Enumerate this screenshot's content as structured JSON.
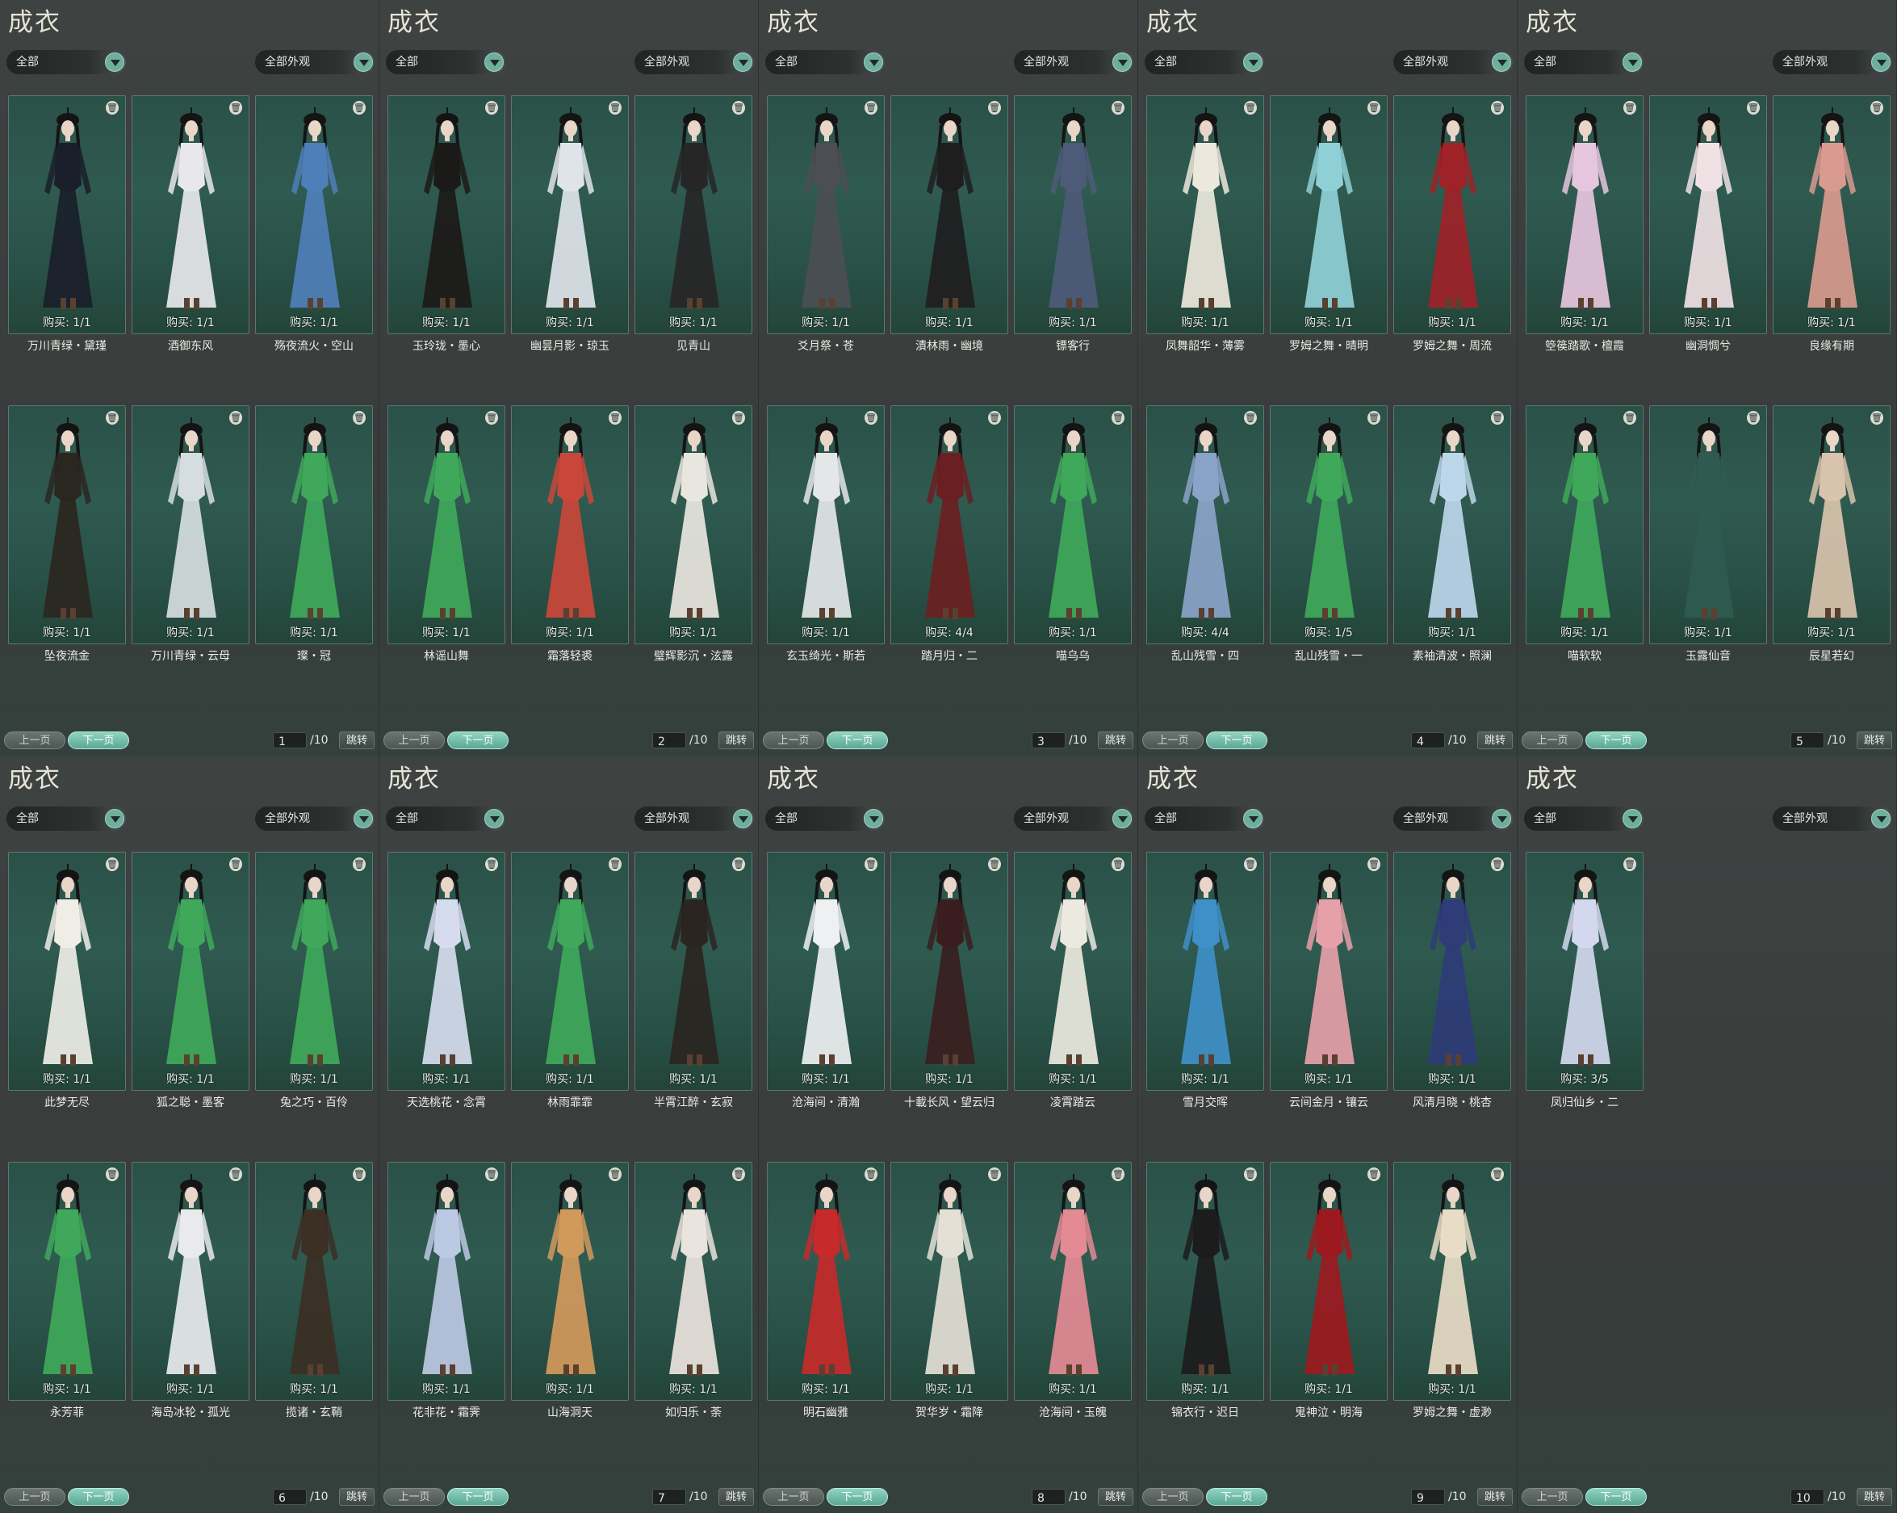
{
  "window": {
    "title": "成衣"
  },
  "colors": {
    "card_bg": "#2a5147",
    "accent": "#6fae9d",
    "page_bg": "#3a3e3d"
  },
  "panels": [
    {
      "title": "成衣",
      "filter_all": "全部",
      "filter_appearance": "全部外观",
      "page": "1",
      "total": "/10",
      "prev": "上一页",
      "next": "下一页",
      "jump": "跳转",
      "items": [
        {
          "name": "万川青绿・黛瑾",
          "buy": "购买: 1/1",
          "fig": "#1a1e2a"
        },
        {
          "name": "酒御东风",
          "buy": "购买: 1/1",
          "fig": "#e8e8ea"
        },
        {
          "name": "殇夜流火・空山",
          "buy": "购买: 1/1",
          "fig": "#4f7fb8"
        },
        {
          "name": "坠夜流金",
          "buy": "购买: 1/1",
          "fig": "#2a2620"
        },
        {
          "name": "万川青绿・云母",
          "buy": "购买: 1/1",
          "fig": "#d6dde0"
        },
        {
          "name": "璨・冠",
          "buy": "购买: 1/1",
          "fig": "#3fa85a"
        }
      ]
    },
    {
      "title": "成衣",
      "filter_all": "全部",
      "filter_appearance": "全部外观",
      "page": "2",
      "total": "/10",
      "prev": "上一页",
      "next": "下一页",
      "jump": "跳转",
      "items": [
        {
          "name": "玉玲珑・墨心",
          "buy": "购买: 1/1",
          "fig": "#1c1a18"
        },
        {
          "name": "幽昙月影・琼玉",
          "buy": "购买: 1/1",
          "fig": "#dfe4ea"
        },
        {
          "name": "见青山",
          "buy": "购买: 1/1",
          "fig": "#262626"
        },
        {
          "name": "林谣山舞",
          "buy": "购买: 1/1",
          "fig": "#3fa85a"
        },
        {
          "name": "霜落轻裘",
          "buy": "购买: 1/1",
          "fig": "#c9473a"
        },
        {
          "name": "璧辉影沉・泫露",
          "buy": "购买: 1/1",
          "fig": "#e9e6df"
        }
      ]
    },
    {
      "title": "成衣",
      "filter_all": "全部",
      "filter_appearance": "全部外观",
      "page": "3",
      "total": "/10",
      "prev": "上一页",
      "next": "下一页",
      "jump": "跳转",
      "items": [
        {
          "name": "爻月祭・苍",
          "buy": "购买: 1/1",
          "fig": "#4b4e52"
        },
        {
          "name": "漬林雨・幽境",
          "buy": "购买: 1/1",
          "fig": "#1e1e1e"
        },
        {
          "name": "镖客行",
          "buy": "购买: 1/1",
          "fig": "#4d5a78"
        },
        {
          "name": "玄玉绮光・斯若",
          "buy": "购买: 1/1",
          "fig": "#e4e6e8"
        },
        {
          "name": "踏月归・二",
          "buy": "购买: 4/4",
          "fig": "#6b1f22"
        },
        {
          "name": "喵乌乌",
          "buy": "购买: 1/1",
          "fig": "#3fa85a"
        }
      ]
    },
    {
      "title": "成衣",
      "filter_all": "全部",
      "filter_appearance": "全部外观",
      "page": "4",
      "total": "/10",
      "prev": "上一页",
      "next": "下一页",
      "jump": "跳转",
      "items": [
        {
          "name": "凤舞韶华・薄雾",
          "buy": "购买: 1/1",
          "fig": "#ece8dc"
        },
        {
          "name": "罗姆之舞・晴明",
          "buy": "购买: 1/1",
          "fig": "#8fd0d6"
        },
        {
          "name": "罗姆之舞・周流",
          "buy": "购买: 1/1",
          "fig": "#9e2228"
        },
        {
          "name": "乱山残雪・四",
          "buy": "购买: 4/4",
          "fig": "#8aa3c8"
        },
        {
          "name": "乱山残雪・一",
          "buy": "购买: 1/5",
          "fig": "#3fa85a"
        },
        {
          "name": "素袖清波・照澜",
          "buy": "购买: 1/1",
          "fig": "#bcd6ea"
        }
      ]
    },
    {
      "title": "成衣",
      "filter_all": "全部",
      "filter_appearance": "全部外观",
      "page": "5",
      "total": "/10",
      "prev": "上一页",
      "next": "下一页",
      "jump": "跳转",
      "items": [
        {
          "name": "箜篌踏歌・檀霞",
          "buy": "购买: 1/1",
          "fig": "#e6c6de"
        },
        {
          "name": "幽洞惆兮",
          "buy": "购买: 1/1",
          "fig": "#efe1e4"
        },
        {
          "name": "良缘有期",
          "buy": "购买: 1/1",
          "fig": "#d99a8f"
        },
        {
          "name": "喵软软",
          "buy": "购买: 1/1",
          "fig": "#3fa85a"
        },
        {
          "name": "玉露仙音",
          "buy": "购买: 1/1",
          "fig": "#2f5a50"
        },
        {
          "name": "辰星若幻",
          "buy": "购买: 1/1",
          "fig": "#d8c3ad"
        }
      ]
    },
    {
      "title": "成衣",
      "filter_all": "全部",
      "filter_appearance": "全部外观",
      "page": "6",
      "total": "/10",
      "prev": "上一页",
      "next": "下一页",
      "jump": "跳转",
      "items": [
        {
          "name": "此梦无尽",
          "buy": "购买: 1/1",
          "fig": "#eeeee6"
        },
        {
          "name": "狐之聪・墨客",
          "buy": "购买: 1/1",
          "fig": "#3fa85a"
        },
        {
          "name": "兔之巧・百伶",
          "buy": "购买: 1/1",
          "fig": "#3fa85a"
        },
        {
          "name": "永芳菲",
          "buy": "购买: 1/1",
          "fig": "#3fa85a"
        },
        {
          "name": "海岛冰轮・孤光",
          "buy": "购买: 1/1",
          "fig": "#e8eaec"
        },
        {
          "name": "揽诸・玄鞘",
          "buy": "购买: 1/1",
          "fig": "#3c2f24"
        }
      ]
    },
    {
      "title": "成衣",
      "filter_all": "全部",
      "filter_appearance": "全部外观",
      "page": "7",
      "total": "/10",
      "prev": "上一页",
      "next": "下一页",
      "jump": "跳转",
      "items": [
        {
          "name": "天选桃花・念霄",
          "buy": "购买: 1/1",
          "fig": "#d6dcee"
        },
        {
          "name": "林雨霏霏",
          "buy": "购买: 1/1",
          "fig": "#3fa85a"
        },
        {
          "name": "半霄江醉・玄寂",
          "buy": "购买: 1/1",
          "fig": "#2a2520"
        },
        {
          "name": "花非花・霜霁",
          "buy": "购买: 1/1",
          "fig": "#bcc9e3"
        },
        {
          "name": "山海洞天",
          "buy": "购买: 1/1",
          "fig": "#d2995c"
        },
        {
          "name": "如归乐・荼",
          "buy": "购买: 1/1",
          "fig": "#ebe3dd"
        }
      ]
    },
    {
      "title": "成衣",
      "filter_all": "全部",
      "filter_appearance": "全部外观",
      "page": "8",
      "total": "/10",
      "prev": "上一页",
      "next": "下一页",
      "jump": "跳转",
      "items": [
        {
          "name": "沧海间・清瀚",
          "buy": "购买: 1/1",
          "fig": "#eef0f2"
        },
        {
          "name": "十載长风・望云归",
          "buy": "购买: 1/1",
          "fig": "#3a1e1f"
        },
        {
          "name": "凌霄踏云",
          "buy": "购买: 1/1",
          "fig": "#ece9e0"
        },
        {
          "name": "明石幽雅",
          "buy": "购买: 1/1",
          "fig": "#c62a2a"
        },
        {
          "name": "贺华岁・霜降",
          "buy": "购买: 1/1",
          "fig": "#e4e0d6"
        },
        {
          "name": "沧海间・玉魄",
          "buy": "购买: 1/1",
          "fig": "#e48a94"
        }
      ]
    },
    {
      "title": "成衣",
      "filter_all": "全部",
      "filter_appearance": "全部外观",
      "page": "9",
      "total": "/10",
      "prev": "上一页",
      "next": "下一页",
      "jump": "跳转",
      "items": [
        {
          "name": "雪月交晖",
          "buy": "购买: 1/1",
          "fig": "#3f8fc8"
        },
        {
          "name": "云间金月・镶云",
          "buy": "购买: 1/1",
          "fig": "#e6a0a8"
        },
        {
          "name": "风清月晓・桃杏",
          "buy": "购买: 1/1",
          "fig": "#2e3c78"
        },
        {
          "name": "锦衣行・迟日",
          "buy": "购买: 1/1",
          "fig": "#1c1c1c"
        },
        {
          "name": "鬼神泣・明海",
          "buy": "购买: 1/1",
          "fig": "#9c1a1f"
        },
        {
          "name": "罗姆之舞・虚渺",
          "buy": "购买: 1/1",
          "fig": "#e8dcc6"
        }
      ]
    },
    {
      "title": "成衣",
      "filter_all": "全部",
      "filter_appearance": "全部外观",
      "page": "10",
      "total": "/10",
      "prev": "上一页",
      "next": "下一页",
      "jump": "跳转",
      "items": [
        {
          "name": "凤归仙乡・二",
          "buy": "购买: 3/5",
          "fig": "#d3d8ee"
        }
      ]
    }
  ]
}
